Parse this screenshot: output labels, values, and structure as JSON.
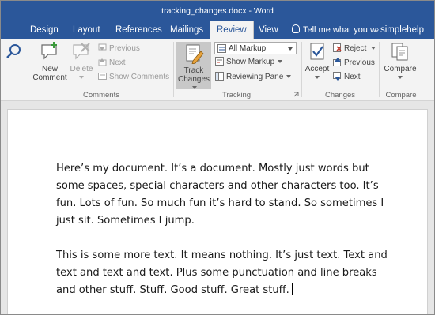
{
  "window": {
    "title": "tracking_changes.docx - Word"
  },
  "tabs": [
    {
      "label": "Design"
    },
    {
      "label": "Layout"
    },
    {
      "label": "References"
    },
    {
      "label": "Mailings"
    },
    {
      "label": "Review",
      "active": true
    },
    {
      "label": "View"
    }
  ],
  "tell_me": {
    "placeholder": "Tell me what you wan"
  },
  "user": {
    "name": "simplehelp"
  },
  "ribbon": {
    "comments": {
      "group_name": "Comments",
      "new_comment": {
        "line1": "New",
        "line2": "Comment"
      },
      "delete": "Delete",
      "previous": "Previous",
      "next": "Next",
      "show_comments": "Show Comments"
    },
    "tracking": {
      "group_name": "Tracking",
      "track_changes": {
        "line1": "Track",
        "line2": "Changes"
      },
      "display_for_review": "All Markup",
      "show_markup": "Show Markup",
      "reviewing_pane": "Reviewing Pane"
    },
    "changes": {
      "group_name": "Changes",
      "accept": "Accept",
      "reject": "Reject",
      "previous": "Previous",
      "next": "Next"
    },
    "compare": {
      "group_name": "Compare",
      "compare": "Compare"
    }
  },
  "document": {
    "paragraphs": [
      "Here’s my document. It’s a document. Mostly just words but some spaces, special characters and other characters too. It’s fun. Lots of fun. So much fun it’s hard to stand. So sometimes I just sit. Sometimes I jump.",
      "This is some more text. It means nothing. It’s just text. Text and text and text and text. Plus some punctuation and line breaks and other stuff. Stuff. Good stuff. Great stuff."
    ]
  },
  "colors": {
    "accent": "#2b579a",
    "ribbon_bg": "#f3f3f3",
    "doc_bg": "#e6e6e6"
  },
  "icons": [
    "smart-lookup-icon",
    "new-comment-icon",
    "delete-comment-icon",
    "previous-comment-icon",
    "next-comment-icon",
    "show-comments-icon",
    "track-changes-icon",
    "markup-icon",
    "show-markup-icon",
    "reviewing-pane-icon",
    "accept-icon",
    "reject-icon",
    "previous-change-icon",
    "next-change-icon",
    "compare-icon",
    "lightbulb-icon",
    "dialog-launcher-icon"
  ]
}
